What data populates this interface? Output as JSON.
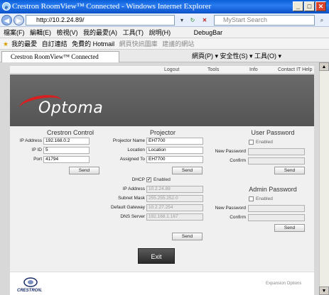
{
  "window": {
    "title": "Crestron RoomView™ Connected - Windows Internet Explorer",
    "min": "_",
    "max": "□",
    "close": "✕"
  },
  "navbar": {
    "address": "http://10.2.24.89/",
    "search_placeholder": "MyStart Search"
  },
  "menu": {
    "items": [
      "檔案(F)",
      "編輯(E)",
      "檢視(V)",
      "我的最愛(A)",
      "工具(T)",
      "說明(H)",
      "DebugBar"
    ]
  },
  "favorites": {
    "label": "我的最愛",
    "items": [
      "自訂連結",
      "免費的 Hotmail",
      "網頁快訊圖庫",
      "建議的網站"
    ]
  },
  "tab": {
    "title": "Crestron RoomView™ Connected",
    "tools": "網頁(P) ▾   安全性(S) ▾   工具(O) ▾"
  },
  "page": {
    "topnav": [
      "Logout",
      "Tools",
      "Info",
      "Contact IT Help"
    ],
    "brand": "Optoma",
    "crestron": {
      "title": "Crestron Control",
      "fields": [
        {
          "label": "IP Address",
          "value": "192.168.0.2"
        },
        {
          "label": "IP ID",
          "value": "5"
        },
        {
          "label": "Port",
          "value": "41794"
        }
      ],
      "send": "Send"
    },
    "projector": {
      "title": "Projector",
      "fields": [
        {
          "label": "Projector Name",
          "value": "EH7700"
        },
        {
          "label": "Location",
          "value": "Location"
        },
        {
          "label": "Assigned To",
          "value": "EH7700"
        }
      ],
      "send1": "Send",
      "dhcp_label": "DHCP",
      "dhcp_enabled": "Enabled",
      "net_fields": [
        {
          "label": "IP Address",
          "value": "10.2.24.89"
        },
        {
          "label": "Subnet Mask",
          "value": "255.255.252.0"
        },
        {
          "label": "Default Gateway",
          "value": "10.2.27.254"
        },
        {
          "label": "DNS Server",
          "value": "192.168.1.167"
        }
      ],
      "send2": "Send"
    },
    "user_password": {
      "title": "User Password",
      "enabled": "Enabled",
      "new_label": "New Password",
      "confirm_label": "Confirm",
      "send": "Send"
    },
    "admin_password": {
      "title": "Admin Password",
      "enabled": "Enabled",
      "new_label": "New Password",
      "confirm_label": "Confirm",
      "send": "Send"
    },
    "exit": "Exit",
    "footer": {
      "crestron_logo": "CRESTRON.",
      "expansion": "Expansion Options"
    }
  },
  "colors": {
    "accent": "#d81e1e",
    "titlebar": "#0a5fd8"
  }
}
